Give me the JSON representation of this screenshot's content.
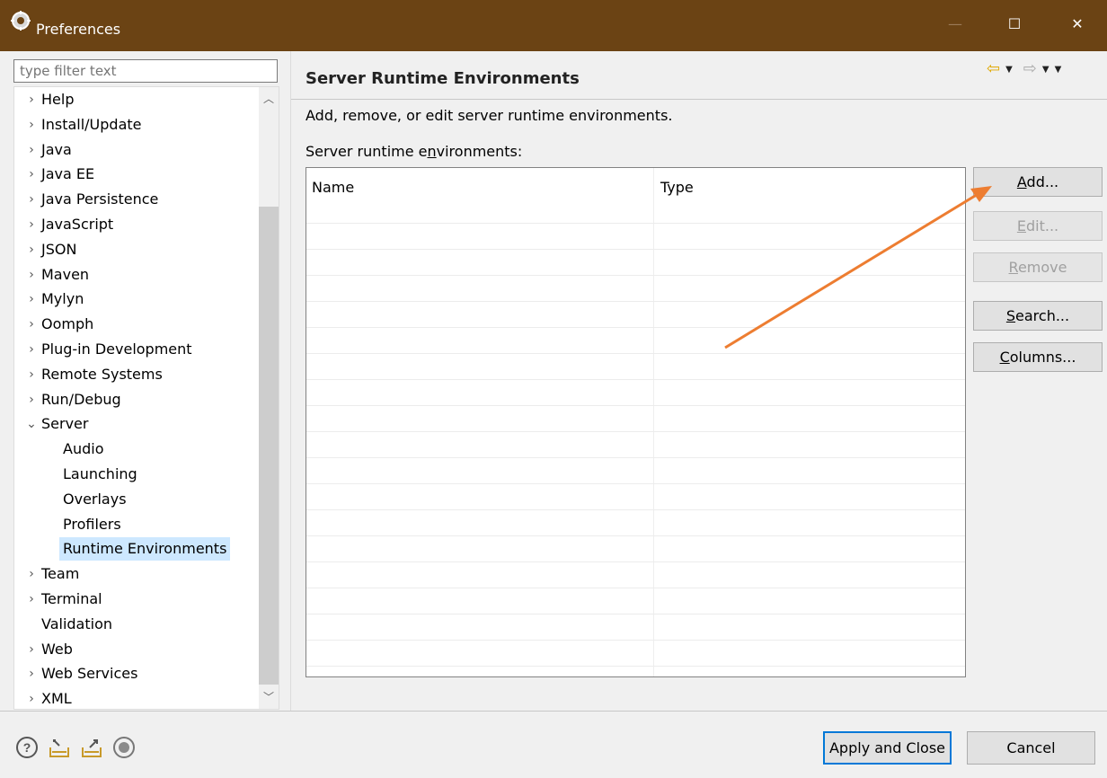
{
  "window": {
    "title": "Preferences",
    "minimize_glyph": "—",
    "maximize_glyph": "☐",
    "close_glyph": "✕"
  },
  "sidebar": {
    "filter_placeholder": "type filter text",
    "items": [
      {
        "label": "Help",
        "twisty": "›",
        "level": 0
      },
      {
        "label": "Install/Update",
        "twisty": "›",
        "level": 0
      },
      {
        "label": "Java",
        "twisty": "›",
        "level": 0
      },
      {
        "label": "Java EE",
        "twisty": "›",
        "level": 0
      },
      {
        "label": "Java Persistence",
        "twisty": "›",
        "level": 0
      },
      {
        "label": "JavaScript",
        "twisty": "›",
        "level": 0
      },
      {
        "label": "JSON",
        "twisty": "›",
        "level": 0
      },
      {
        "label": "Maven",
        "twisty": "›",
        "level": 0
      },
      {
        "label": "Mylyn",
        "twisty": "›",
        "level": 0
      },
      {
        "label": "Oomph",
        "twisty": "›",
        "level": 0
      },
      {
        "label": "Plug-in Development",
        "twisty": "›",
        "level": 0
      },
      {
        "label": "Remote Systems",
        "twisty": "›",
        "level": 0
      },
      {
        "label": "Run/Debug",
        "twisty": "›",
        "level": 0
      },
      {
        "label": "Server",
        "twisty": "⌄",
        "level": 0
      },
      {
        "label": "Audio",
        "twisty": "",
        "level": 1
      },
      {
        "label": "Launching",
        "twisty": "",
        "level": 1
      },
      {
        "label": "Overlays",
        "twisty": "",
        "level": 1
      },
      {
        "label": "Profilers",
        "twisty": "",
        "level": 1
      },
      {
        "label": "Runtime Environments",
        "twisty": "",
        "level": 1,
        "selected": true
      },
      {
        "label": "Team",
        "twisty": "›",
        "level": 0
      },
      {
        "label": "Terminal",
        "twisty": "›",
        "level": 0
      },
      {
        "label": "Validation",
        "twisty": "",
        "level": 0
      },
      {
        "label": "Web",
        "twisty": "›",
        "level": 0
      },
      {
        "label": "Web Services",
        "twisty": "›",
        "level": 0
      },
      {
        "label": "XML",
        "twisty": "›",
        "level": 0
      }
    ],
    "scroll_up_glyph": "︿",
    "scroll_down_glyph": "﹀"
  },
  "page": {
    "title": "Server Runtime Environments",
    "description": "Add, remove, or edit server runtime environments.",
    "list_label_before": "Server runtime e",
    "list_label_mnemonic": "n",
    "list_label_after": "vironments:",
    "nav": {
      "back_glyph": "⇦",
      "forward_glyph": "⇨",
      "dropdown_glyph": "▼"
    },
    "table": {
      "columns": [
        "Name",
        "Type"
      ],
      "rows": []
    },
    "buttons": [
      {
        "mnemonic": "A",
        "rest": "dd...",
        "enabled": true
      },
      {
        "mnemonic": "E",
        "rest": "dit...",
        "enabled": false
      },
      {
        "mnemonic": "R",
        "rest": "emove",
        "enabled": false
      },
      {
        "mnemonic": "S",
        "rest": "earch...",
        "enabled": true
      },
      {
        "mnemonic": "C",
        "rest": "olumns...",
        "enabled": true
      }
    ]
  },
  "footer": {
    "apply_close_label": "Apply and Close",
    "cancel_label": "Cancel",
    "icons": [
      "help-icon",
      "import-icon",
      "export-icon",
      "record-icon"
    ]
  },
  "colors": {
    "titlebar": "#6b4314",
    "selection": "#cde8ff",
    "annotation_arrow": "#ed7d31",
    "default_button_border": "#0078d7"
  }
}
